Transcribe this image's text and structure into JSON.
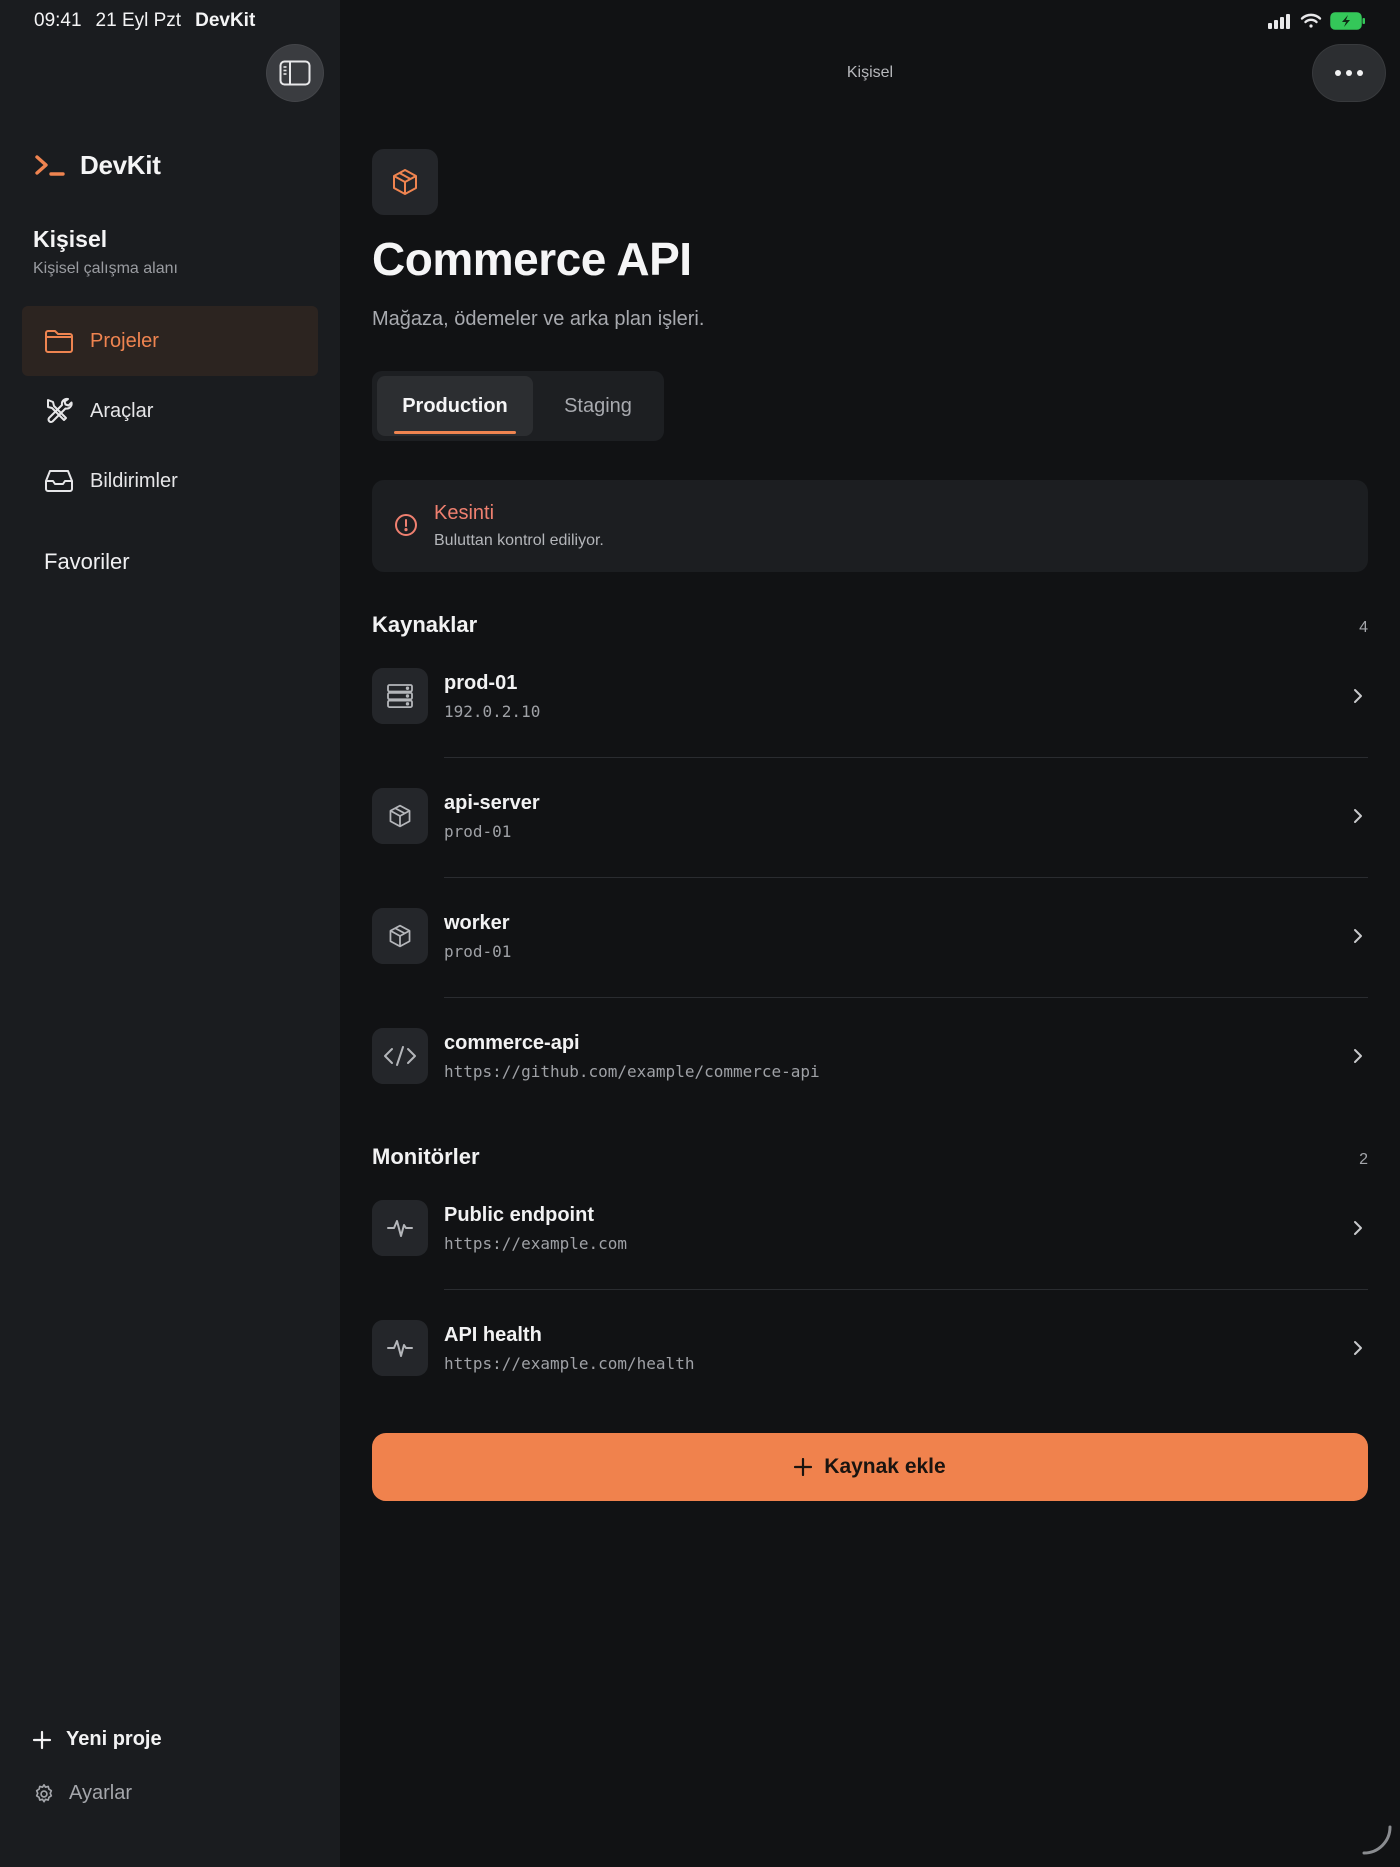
{
  "status_bar": {
    "time": "09:41",
    "date": "21 Eyl Pzt",
    "app": "DevKit",
    "battery_color": "#34c759"
  },
  "sidebar": {
    "brand": "DevKit",
    "workspace_title": "Kişisel",
    "workspace_subtitle": "Kişisel çalışma alanı",
    "nav": [
      {
        "label": "Projeler",
        "icon": "folder-icon",
        "active": true
      },
      {
        "label": "Araçlar",
        "icon": "tools-icon",
        "active": false
      },
      {
        "label": "Bildirimler",
        "icon": "inbox-icon",
        "active": false
      }
    ],
    "favorites_label": "Favoriler",
    "new_project_label": "Yeni proje",
    "settings_label": "Ayarlar"
  },
  "header": {
    "title": "Kişisel"
  },
  "project": {
    "name": "Commerce API",
    "description": "Mağaza, ödemeler ve arka plan işleri.",
    "icon": "box-icon"
  },
  "environments": {
    "tabs": [
      {
        "label": "Production",
        "active": true
      },
      {
        "label": "Staging",
        "active": false
      }
    ]
  },
  "alert": {
    "title": "Kesinti",
    "message": "Buluttan kontrol ediliyor.",
    "color": "#ef8070"
  },
  "resources": {
    "title": "Kaynaklar",
    "count": "4",
    "items": [
      {
        "name": "prod-01",
        "detail": "192.0.2.10",
        "icon": "server-icon"
      },
      {
        "name": "api-server",
        "detail": "prod-01",
        "icon": "box-icon"
      },
      {
        "name": "worker",
        "detail": "prod-01",
        "icon": "box-icon"
      },
      {
        "name": "commerce-api",
        "detail": "https://github.com/example/commerce-api",
        "icon": "code-icon"
      }
    ]
  },
  "monitors": {
    "title": "Monitörler",
    "count": "2",
    "items": [
      {
        "name": "Public endpoint",
        "detail": "https://example.com",
        "icon": "pulse-icon"
      },
      {
        "name": "API health",
        "detail": "https://example.com/health",
        "icon": "pulse-icon"
      }
    ]
  },
  "actions": {
    "add_resource_label": "Kaynak ekle"
  },
  "theme": {
    "accent": "#ef8450",
    "background": "#111214",
    "sidebar": "#1a1c1f"
  }
}
